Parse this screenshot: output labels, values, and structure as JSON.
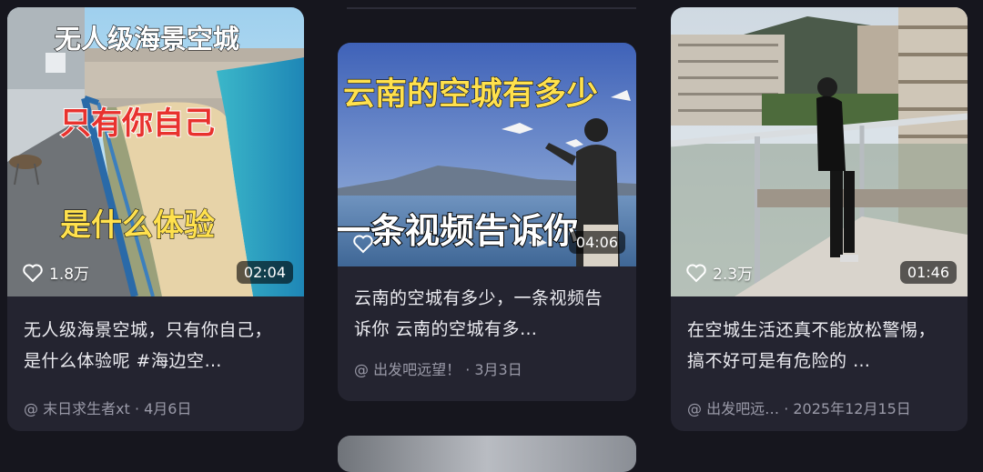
{
  "cards": [
    {
      "overlay": [
        "无人级海景空城",
        "只有你自己",
        "是什么体验"
      ],
      "likes": "1.8万",
      "duration": "02:04",
      "title": "无人级海景空城，只有你自己，是什么体验呢 #海边空…",
      "author": "@ 末日求生者xt",
      "date": "· 4月6日"
    },
    {
      "overlay": [
        "云南的空城有多少",
        "一条视频告诉你"
      ],
      "likes": "",
      "duration": "04:06",
      "title": "云南的空城有多少，一条视频告诉你 云南的空城有多…",
      "author": "@ 出发吧远望！",
      "date": "· 3月3日"
    },
    {
      "overlay": [],
      "likes": "2.3万",
      "duration": "01:46",
      "title": "在空城生活还真不能放松警惕，搞不好可是有危险的 …",
      "author": "@ 出发吧远…",
      "date": "· 2025年12月15日"
    }
  ],
  "colors": {
    "background": "#16161e",
    "card": "#242430",
    "overlay_yellow": "#ffe14d",
    "overlay_red": "#e8322e"
  }
}
